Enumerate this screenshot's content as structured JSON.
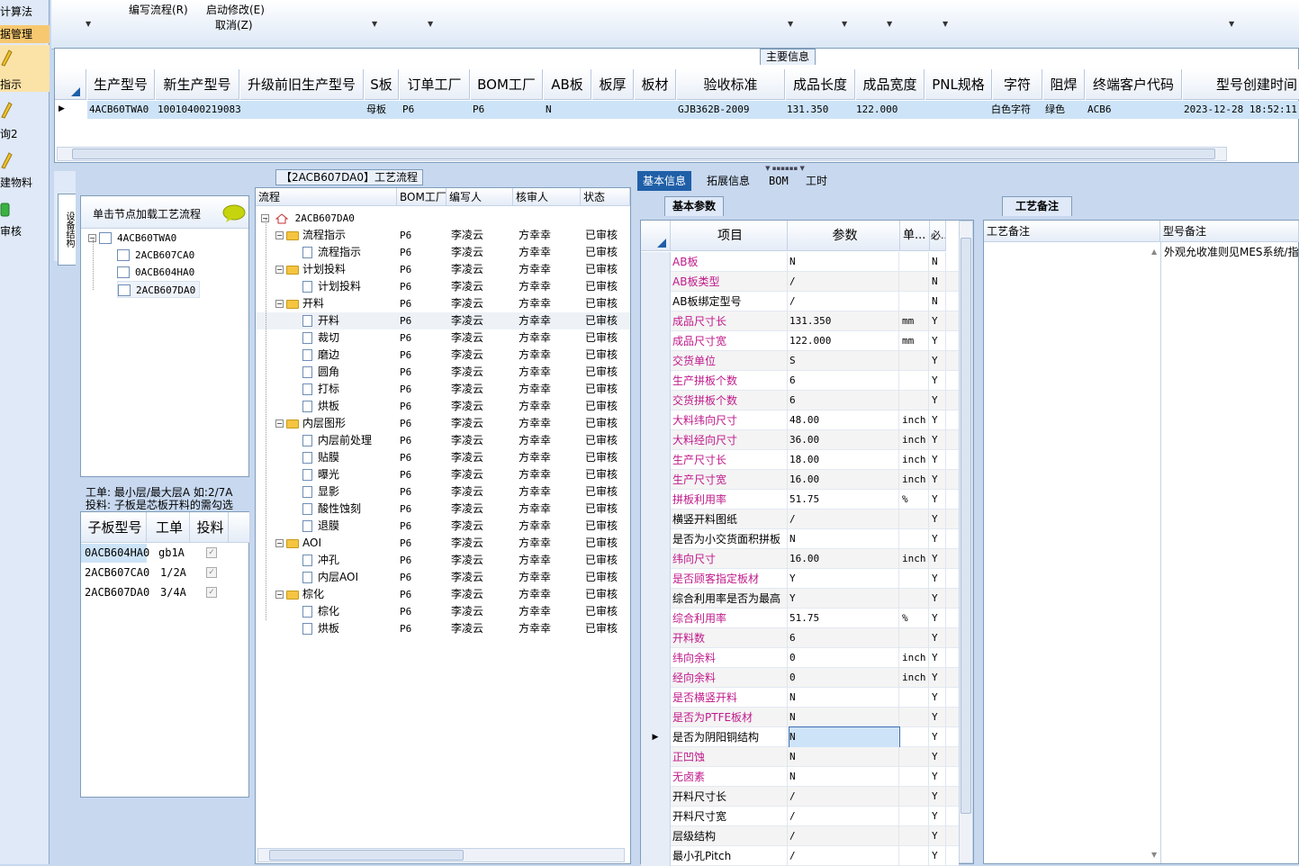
{
  "left_nav": {
    "items": [
      {
        "label": "计算法",
        "icon": "calc-icon"
      },
      {
        "label": "据管理",
        "icon": "data-icon"
      },
      {
        "label": "指示",
        "icon": "pencil-icon"
      },
      {
        "label": "询2",
        "icon": "pencil-icon"
      },
      {
        "label": "建物料",
        "icon": "pencil-icon"
      },
      {
        "label": "审核",
        "icon": "check-icon"
      }
    ]
  },
  "ribbon": {
    "edit_flow": "编写流程(R)",
    "start_modify": "启动修改(E)",
    "cancel": "取消(Z)"
  },
  "main_info": {
    "title": "主要信息",
    "columns": [
      "生产型号",
      "新生产型号",
      "升级前旧生产型号",
      "S板",
      "订单工厂",
      "BOM工厂",
      "AB板",
      "板厚",
      "板材",
      "验收标准",
      "成品长度",
      "成品宽度",
      "PNL规格",
      "字符",
      "阻焊",
      "终端客户代码",
      "型号创建时间"
    ],
    "row": {
      "model": "4ACB60TWA0",
      "new_model": "10010400219083",
      "s_board": "母板",
      "order_factory": "P6",
      "bom_factory": "P6",
      "ab_board": "N",
      "standard": "GJB362B-2009",
      "length": "131.350",
      "width": "122.000",
      "char": "白色字符",
      "solder": "绿色",
      "client_code": "ACB6",
      "created": "2023-12-28 18:52:11"
    }
  },
  "structure_panel": {
    "side_tab": "设备结构",
    "hint": "单击节点加载工艺流程",
    "tree": [
      "4ACB60TWA0",
      "2ACB607CA0",
      "0ACB604HA0",
      "2ACB607DA0"
    ],
    "note1": "工单: 最小层/最大层A 如:2/7A",
    "note2": "投料: 子板是芯板开料的需勾选",
    "sub_headers": [
      "子板型号",
      "工单",
      "投料"
    ],
    "sub_rows": [
      {
        "model": "0ACB604HA0",
        "order": "gb1A"
      },
      {
        "model": "2ACB607CA0",
        "order": "1/2A"
      },
      {
        "model": "2ACB607DA0",
        "order": "3/4A"
      }
    ]
  },
  "flow_panel": {
    "title": "【2ACB607DA0】工艺流程",
    "headers": [
      "流程",
      "BOM工厂",
      "编写人",
      "核审人",
      "状态"
    ],
    "root": "2ACB607DA0",
    "factory": "P6",
    "author": "李凌云",
    "reviewer": "方幸幸",
    "status": "已审核",
    "nodes": [
      {
        "label": "流程指示",
        "type": "folder",
        "level": 1
      },
      {
        "label": "流程指示",
        "type": "doc",
        "level": 2
      },
      {
        "label": "计划投料",
        "type": "folder",
        "level": 1
      },
      {
        "label": "计划投料",
        "type": "doc",
        "level": 2
      },
      {
        "label": "开料",
        "type": "folder",
        "level": 1
      },
      {
        "label": "开料",
        "type": "doc",
        "level": 2
      },
      {
        "label": "裁切",
        "type": "doc",
        "level": 2
      },
      {
        "label": "磨边",
        "type": "doc",
        "level": 2
      },
      {
        "label": "圆角",
        "type": "doc",
        "level": 2
      },
      {
        "label": "打标",
        "type": "doc",
        "level": 2
      },
      {
        "label": "烘板",
        "type": "doc",
        "level": 2
      },
      {
        "label": "内层图形",
        "type": "folder",
        "level": 1
      },
      {
        "label": "内层前处理",
        "type": "doc",
        "level": 2
      },
      {
        "label": "贴膜",
        "type": "doc",
        "level": 2
      },
      {
        "label": "曝光",
        "type": "doc",
        "level": 2
      },
      {
        "label": "显影",
        "type": "doc",
        "level": 2
      },
      {
        "label": "酸性蚀刻",
        "type": "doc",
        "level": 2
      },
      {
        "label": "退膜",
        "type": "doc",
        "level": 2
      },
      {
        "label": "AOI",
        "type": "folder",
        "level": 1
      },
      {
        "label": "冲孔",
        "type": "doc",
        "level": 2
      },
      {
        "label": "内层AOI",
        "type": "doc",
        "level": 2
      },
      {
        "label": "棕化",
        "type": "folder",
        "level": 1
      },
      {
        "label": "棕化",
        "type": "doc",
        "level": 2
      },
      {
        "label": "烘板",
        "type": "doc",
        "level": 2
      }
    ]
  },
  "detail_tabs": [
    "基本信息",
    "拓展信息",
    "BOM",
    "工时"
  ],
  "basic_params": {
    "title": "基本参数",
    "headers": [
      "项目",
      "参数",
      "单...",
      "必..."
    ],
    "rows": [
      {
        "item": "AB板",
        "value": "N",
        "unit": "",
        "req": "N",
        "pink": true
      },
      {
        "item": "AB板类型",
        "value": "/",
        "unit": "",
        "req": "N",
        "pink": true
      },
      {
        "item": "AB板绑定型号",
        "value": "/",
        "unit": "",
        "req": "N",
        "pink": false
      },
      {
        "item": "成品尺寸长",
        "value": "131.350",
        "unit": "mm",
        "req": "Y",
        "pink": true
      },
      {
        "item": "成品尺寸宽",
        "value": "122.000",
        "unit": "mm",
        "req": "Y",
        "pink": true
      },
      {
        "item": "交货单位",
        "value": "S",
        "unit": "",
        "req": "Y",
        "pink": true
      },
      {
        "item": "生产拼板个数",
        "value": "6",
        "unit": "",
        "req": "Y",
        "pink": true
      },
      {
        "item": "交货拼板个数",
        "value": "6",
        "unit": "",
        "req": "Y",
        "pink": true
      },
      {
        "item": "大料纬向尺寸",
        "value": "48.00",
        "unit": "inch",
        "req": "Y",
        "pink": true
      },
      {
        "item": "大料经向尺寸",
        "value": "36.00",
        "unit": "inch",
        "req": "Y",
        "pink": true
      },
      {
        "item": "生产尺寸长",
        "value": "18.00",
        "unit": "inch",
        "req": "Y",
        "pink": true
      },
      {
        "item": "生产尺寸宽",
        "value": "16.00",
        "unit": "inch",
        "req": "Y",
        "pink": true
      },
      {
        "item": "拼板利用率",
        "value": "51.75",
        "unit": "%",
        "req": "Y",
        "pink": true
      },
      {
        "item": "横竖开料图纸",
        "value": "/",
        "unit": "",
        "req": "Y",
        "pink": false
      },
      {
        "item": "是否为小交货面积拼板",
        "value": "N",
        "unit": "",
        "req": "Y",
        "pink": false
      },
      {
        "item": "纬向尺寸",
        "value": "16.00",
        "unit": "inch",
        "req": "Y",
        "pink": true
      },
      {
        "item": "是否顾客指定板材",
        "value": "Y",
        "unit": "",
        "req": "Y",
        "pink": true
      },
      {
        "item": "综合利用率是否为最高",
        "value": "Y",
        "unit": "",
        "req": "Y",
        "pink": false
      },
      {
        "item": "综合利用率",
        "value": "51.75",
        "unit": "%",
        "req": "Y",
        "pink": true
      },
      {
        "item": "开料数",
        "value": "6",
        "unit": "",
        "req": "Y",
        "pink": true
      },
      {
        "item": "纬向余料",
        "value": "0",
        "unit": "inch",
        "req": "Y",
        "pink": true
      },
      {
        "item": "经向余料",
        "value": "0",
        "unit": "inch",
        "req": "Y",
        "pink": true
      },
      {
        "item": "是否横竖开料",
        "value": "N",
        "unit": "",
        "req": "Y",
        "pink": true
      },
      {
        "item": "是否为PTFE板材",
        "value": "N",
        "unit": "",
        "req": "Y",
        "pink": true
      },
      {
        "item": "是否为阴阳铜结构",
        "value": "N",
        "unit": "",
        "req": "Y",
        "pink": false
      },
      {
        "item": "正凹蚀",
        "value": "N",
        "unit": "",
        "req": "Y",
        "pink": true
      },
      {
        "item": "无卤素",
        "value": "N",
        "unit": "",
        "req": "Y",
        "pink": true
      },
      {
        "item": "开料尺寸长",
        "value": "/",
        "unit": "",
        "req": "Y",
        "pink": false
      },
      {
        "item": "开料尺寸宽",
        "value": "/",
        "unit": "",
        "req": "Y",
        "pink": false
      },
      {
        "item": "层级结构",
        "value": "/",
        "unit": "",
        "req": "Y",
        "pink": false
      },
      {
        "item": "最小孔Pitch",
        "value": "/",
        "unit": "",
        "req": "Y",
        "pink": false
      }
    ]
  },
  "remarks": {
    "title": "工艺备注",
    "col1": "工艺备注",
    "col2": "型号备注",
    "model_remark": "外观允收准则见MES系统/指示"
  },
  "colors": {
    "pink": "#c0198a",
    "selected": "#cde3f7",
    "header_blue": "#1f5fa8"
  }
}
